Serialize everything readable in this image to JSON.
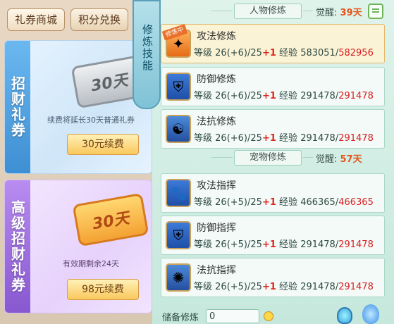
{
  "shop": {
    "tabs": [
      "礼券商城",
      "积分兑换"
    ],
    "cards": [
      {
        "ribbon": "招财礼券",
        "ticket_text": "30天",
        "desc": "续费将延长30天普通礼券",
        "button": "30元续费"
      },
      {
        "ribbon": "高级招财礼券",
        "ticket_text": "30天",
        "desc": "有效期剩余24天",
        "button": "98元续费"
      }
    ]
  },
  "side_label": "修炼技能",
  "character": {
    "title": "人物修炼",
    "awaken_label": "觉醒:",
    "awaken_value": "39天",
    "skills": [
      {
        "name": "攻法修炼",
        "tag": "修炼中",
        "level_label": "等级",
        "level": "26(+6)/25",
        "plus": "+1",
        "exp_label": "经验",
        "exp_cur": "583051",
        "exp_max": "582956",
        "icon": "claw-icon"
      },
      {
        "name": "防御修炼",
        "level_label": "等级",
        "level": "26(+6)/25",
        "plus": "+1",
        "exp_label": "经验",
        "exp_cur": "291478",
        "exp_max": "291478",
        "icon": "shield-icon"
      },
      {
        "name": "法抗修炼",
        "level_label": "等级",
        "level": "26(+6)/25",
        "plus": "+1",
        "exp_label": "经验",
        "exp_cur": "291478",
        "exp_max": "291478",
        "icon": "yinyang-shield-icon"
      }
    ]
  },
  "pet": {
    "title": "宠物修炼",
    "awaken_label": "觉醒:",
    "awaken_value": "57天",
    "skills": [
      {
        "name": "攻法指挥",
        "level_label": "等级",
        "level": "26(+5)/25",
        "plus": "+1",
        "exp_label": "经验",
        "exp_cur": "466365",
        "exp_max": "466365",
        "icon": "paw-claw-icon"
      },
      {
        "name": "防御指挥",
        "level_label": "等级",
        "level": "26(+5)/25",
        "plus": "+1",
        "exp_label": "经验",
        "exp_cur": "291478",
        "exp_max": "291478",
        "icon": "paw-shield-icon"
      },
      {
        "name": "法抗指挥",
        "level_label": "等级",
        "level": "26(+5)/25",
        "plus": "+1",
        "exp_label": "经验",
        "exp_cur": "291478",
        "exp_max": "291478",
        "icon": "paw-magic-icon"
      }
    ]
  },
  "reserve": {
    "label": "储备修炼",
    "value": "0"
  }
}
